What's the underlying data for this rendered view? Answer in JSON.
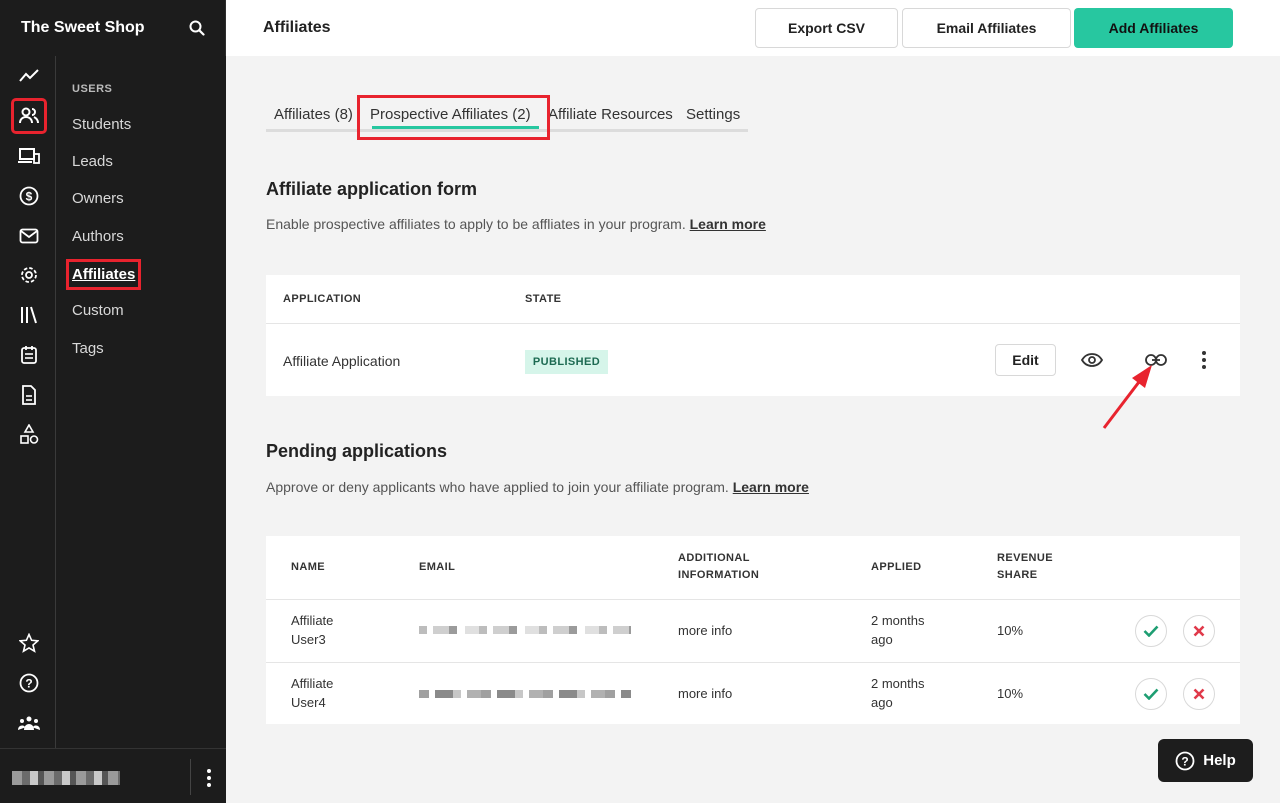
{
  "app": {
    "title": "The Sweet Shop"
  },
  "rail_icons": [
    "trend-icon",
    "users-icon",
    "devices-icon",
    "dollar-icon",
    "mail-icon",
    "settings-icon",
    "library-icon",
    "calendar-icon",
    "document-icon",
    "shapes-icon",
    "star-icon",
    "help-circle-icon",
    "community-icon"
  ],
  "subnav": {
    "heading": "USERS",
    "items": [
      {
        "label": "Students"
      },
      {
        "label": "Leads"
      },
      {
        "label": "Owners"
      },
      {
        "label": "Authors"
      },
      {
        "label": "Affiliates"
      },
      {
        "label": "Custom"
      },
      {
        "label": "Tags"
      }
    ]
  },
  "header": {
    "title": "Affiliates",
    "export_label": "Export CSV",
    "email_label": "Email Affiliates",
    "add_label": "Add Affiliates"
  },
  "tabs": [
    {
      "label": "Affiliates (8)"
    },
    {
      "label": "Prospective Affiliates (2)"
    },
    {
      "label": "Affiliate Resources"
    },
    {
      "label": "Settings"
    }
  ],
  "form_section": {
    "title": "Affiliate application form",
    "description": "Enable prospective affiliates to apply to be affliates in your program.",
    "learn_more": "Learn more",
    "columns": {
      "application": "APPLICATION",
      "state": "STATE"
    },
    "row": {
      "name": "Affiliate Application",
      "state": "PUBLISHED",
      "edit_label": "Edit"
    }
  },
  "pending_section": {
    "title": "Pending applications",
    "description": "Approve or deny applicants who have applied to join your affiliate program.",
    "learn_more": "Learn more",
    "columns": {
      "name": "NAME",
      "email": "EMAIL",
      "additional_1": "ADDITIONAL",
      "additional_2": "INFORMATION",
      "applied": "APPLIED",
      "revenue_1": "REVENUE",
      "revenue_2": "SHARE"
    },
    "rows": [
      {
        "name_1": "Affiliate",
        "name_2": "User3",
        "info": "more info",
        "applied_1": "2 months",
        "applied_2": "ago",
        "share": "10%"
      },
      {
        "name_1": "Affiliate",
        "name_2": "User4",
        "info": "more info",
        "applied_1": "2 months",
        "applied_2": "ago",
        "share": "10%"
      }
    ]
  },
  "help": {
    "label": "Help"
  },
  "colors": {
    "accent": "#27c7a0",
    "highlight": "#e8232e",
    "approve": "#1e9e72",
    "deny": "#e0394a"
  }
}
